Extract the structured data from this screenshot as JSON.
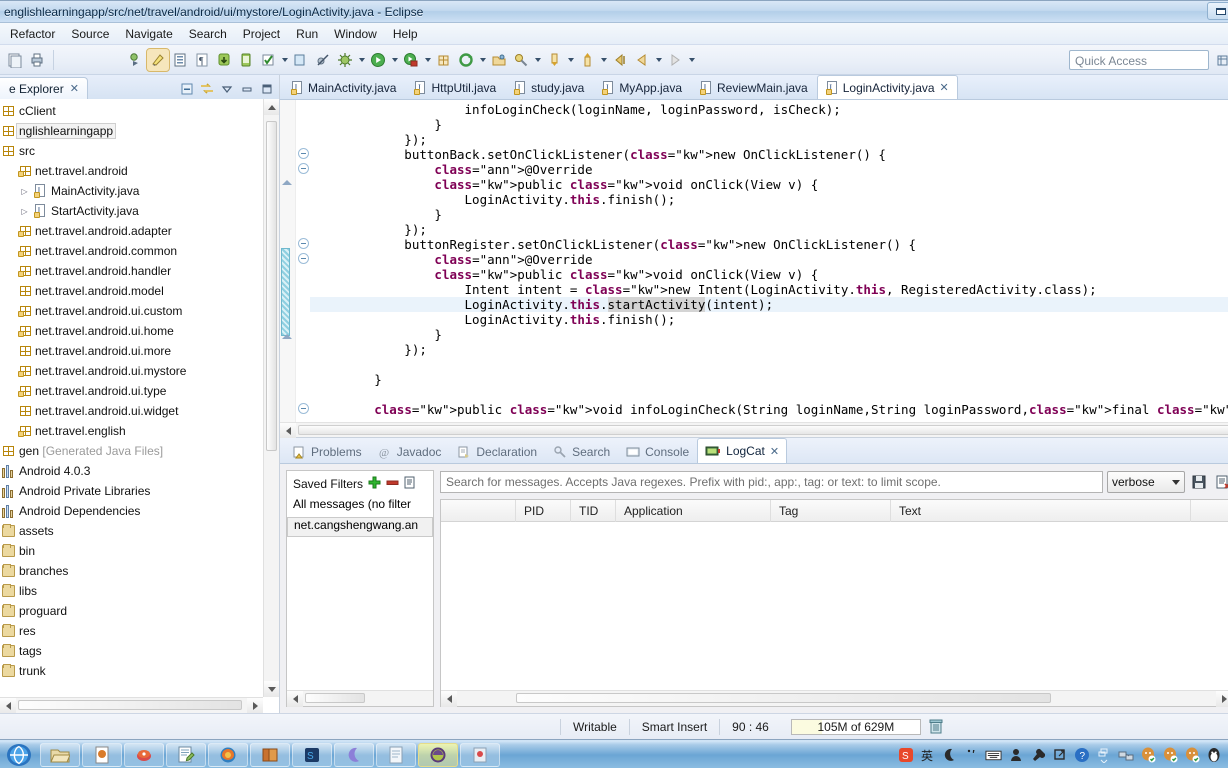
{
  "window": {
    "title": "englishlearningapp/src/net/travel/android/ui/mystore/LoginActivity.java - Eclipse",
    "restore_button": "restore-button"
  },
  "menubar": {
    "items": [
      "Refactor",
      "Source",
      "Navigate",
      "Search",
      "Project",
      "Run",
      "Window",
      "Help"
    ]
  },
  "toolbar": {
    "quick_access_placeholder": "Quick Access",
    "icons": [
      "new-wizard-icon",
      "print-icon",
      "debug-as-icon",
      "edit-highlight-icon",
      "toggle-block-selection-icon",
      "show-whitespace-icon",
      "android-sdk-manager-icon",
      "android-virtual-device-manager-icon",
      "check-icon",
      "new-android-icon",
      "skip-breakpoints-icon",
      "debug-icon",
      "run-icon",
      "run-coverage-icon",
      "new-java-package-icon",
      "refresh-icon",
      "open-folder-icon",
      "search-icon",
      "previous-edit-icon",
      "next-annotation-icon",
      "back-icon",
      "forward-icon"
    ]
  },
  "explorer": {
    "tab_label": "e Explorer",
    "tools": [
      "collapse-all-icon",
      "link-with-editor-icon",
      "view-menu-icon",
      "minimize-icon",
      "maximize-icon"
    ],
    "tree": [
      {
        "label": "cClient",
        "icon": "project-icon",
        "indent": 0,
        "arrow": "",
        "selected": false,
        "gray": false
      },
      {
        "label": "nglishlearningapp",
        "icon": "project-icon",
        "indent": 0,
        "arrow": "",
        "selected": true,
        "gray": false
      },
      {
        "label": "src",
        "icon": "source-folder-icon",
        "indent": 0,
        "arrow": "",
        "selected": false,
        "gray": false
      },
      {
        "label": "net.travel.android",
        "icon": "package-icon",
        "indent": 1,
        "arrow": "",
        "selected": false,
        "gray": false
      },
      {
        "label": "MainActivity.java",
        "icon": "java-file-icon",
        "indent": 2,
        "arrow": "collapsed",
        "selected": false,
        "gray": false
      },
      {
        "label": "StartActivity.java",
        "icon": "java-file-icon",
        "indent": 2,
        "arrow": "collapsed",
        "selected": false,
        "gray": false
      },
      {
        "label": "net.travel.android.adapter",
        "icon": "package-icon",
        "indent": 1,
        "arrow": "",
        "selected": false,
        "gray": false
      },
      {
        "label": "net.travel.android.common",
        "icon": "package-icon",
        "indent": 1,
        "arrow": "",
        "selected": false,
        "gray": false
      },
      {
        "label": "net.travel.android.handler",
        "icon": "package-icon",
        "indent": 1,
        "arrow": "",
        "selected": false,
        "gray": false
      },
      {
        "label": "net.travel.android.model",
        "icon": "package-empty-icon",
        "indent": 1,
        "arrow": "",
        "selected": false,
        "gray": false
      },
      {
        "label": "net.travel.android.ui.custom",
        "icon": "package-icon",
        "indent": 1,
        "arrow": "",
        "selected": false,
        "gray": false
      },
      {
        "label": "net.travel.android.ui.home",
        "icon": "package-icon",
        "indent": 1,
        "arrow": "",
        "selected": false,
        "gray": false
      },
      {
        "label": "net.travel.android.ui.more",
        "icon": "package-empty-icon",
        "indent": 1,
        "arrow": "",
        "selected": false,
        "gray": false
      },
      {
        "label": "net.travel.android.ui.mystore",
        "icon": "package-icon",
        "indent": 1,
        "arrow": "",
        "selected": false,
        "gray": false
      },
      {
        "label": "net.travel.android.ui.type",
        "icon": "package-icon",
        "indent": 1,
        "arrow": "",
        "selected": false,
        "gray": false
      },
      {
        "label": "net.travel.android.ui.widget",
        "icon": "package-empty-icon",
        "indent": 1,
        "arrow": "",
        "selected": false,
        "gray": false
      },
      {
        "label": "net.travel.english",
        "icon": "package-icon",
        "indent": 1,
        "arrow": "",
        "selected": false,
        "gray": false
      },
      {
        "label": "gen [Generated Java Files]",
        "icon": "source-folder-icon",
        "indent": 0,
        "arrow": "",
        "selected": false,
        "gray": true
      },
      {
        "label": "Android 4.0.3",
        "icon": "library-icon",
        "indent": 0,
        "arrow": "",
        "selected": false,
        "gray": false
      },
      {
        "label": "Android Private Libraries",
        "icon": "library-icon",
        "indent": 0,
        "arrow": "",
        "selected": false,
        "gray": false
      },
      {
        "label": "Android Dependencies",
        "icon": "library-icon",
        "indent": 0,
        "arrow": "",
        "selected": false,
        "gray": false
      },
      {
        "label": "assets",
        "icon": "folder-icon",
        "indent": 0,
        "arrow": "collapsed",
        "selected": false,
        "gray": false
      },
      {
        "label": "bin",
        "icon": "folder-icon",
        "indent": 0,
        "arrow": "collapsed",
        "selected": false,
        "gray": false
      },
      {
        "label": "branches",
        "icon": "folder-icon",
        "indent": 0,
        "arrow": "collapsed",
        "selected": false,
        "gray": false
      },
      {
        "label": "libs",
        "icon": "folder-icon",
        "indent": 0,
        "arrow": "collapsed",
        "selected": false,
        "gray": false
      },
      {
        "label": "proguard",
        "icon": "folder-icon",
        "indent": 0,
        "arrow": "collapsed",
        "selected": false,
        "gray": false
      },
      {
        "label": "res",
        "icon": "folder-icon",
        "indent": 0,
        "arrow": "collapsed",
        "selected": false,
        "gray": false
      },
      {
        "label": "tags",
        "icon": "folder-icon",
        "indent": 0,
        "arrow": "collapsed",
        "selected": false,
        "gray": false
      },
      {
        "label": "trunk",
        "icon": "folder-icon",
        "indent": 0,
        "arrow": "collapsed",
        "selected": false,
        "gray": false
      }
    ]
  },
  "editor": {
    "tabs": [
      {
        "label": "MainActivity.java",
        "active": false
      },
      {
        "label": "HttpUtil.java",
        "active": false
      },
      {
        "label": "study.java",
        "active": false
      },
      {
        "label": "MyApp.java",
        "active": false
      },
      {
        "label": "ReviewMain.java",
        "active": false
      },
      {
        "label": "LoginActivity.java",
        "active": true
      }
    ],
    "code_lines": [
      {
        "text": "                    infoLoginCheck(loginName, loginPassword, isCheck);",
        "hl": false
      },
      {
        "text": "                }",
        "hl": false
      },
      {
        "text": "            });",
        "hl": false
      },
      {
        "text": "            buttonBack.setOnClickListener(new OnClickListener() {",
        "hl": false
      },
      {
        "text": "                @Override",
        "hl": false
      },
      {
        "text": "                public void onClick(View v) {",
        "hl": false
      },
      {
        "text": "                    LoginActivity.this.finish();",
        "hl": false
      },
      {
        "text": "                }",
        "hl": false
      },
      {
        "text": "            });",
        "hl": false
      },
      {
        "text": "            buttonRegister.setOnClickListener(new OnClickListener() {",
        "hl": false
      },
      {
        "text": "                @Override",
        "hl": false
      },
      {
        "text": "                public void onClick(View v) {",
        "hl": false
      },
      {
        "text": "                    Intent intent = new Intent(LoginActivity.this, RegisteredActivity.class);",
        "hl": false
      },
      {
        "text": "                    LoginActivity.this.startActivity(intent);",
        "hl": true
      },
      {
        "text": "                    LoginActivity.this.finish();",
        "hl": false
      },
      {
        "text": "                }",
        "hl": false
      },
      {
        "text": "            });",
        "hl": false
      },
      {
        "text": "",
        "hl": false
      },
      {
        "text": "        }",
        "hl": false
      },
      {
        "text": "",
        "hl": false
      },
      {
        "text": "        public void infoLoginCheck(String loginName,String loginPassword,final boolean isCheck){",
        "hl": false
      }
    ]
  },
  "logcat": {
    "tabs": [
      {
        "label": "Problems",
        "icon": "problems-icon",
        "active": false
      },
      {
        "label": "Javadoc",
        "icon": "javadoc-icon",
        "active": false
      },
      {
        "label": "Declaration",
        "icon": "declaration-icon",
        "active": false
      },
      {
        "label": "Search",
        "icon": "search-icon",
        "active": false
      },
      {
        "label": "Console",
        "icon": "console-icon",
        "active": false
      },
      {
        "label": "LogCat",
        "icon": "logcat-icon",
        "active": true
      }
    ],
    "filters": {
      "title": "Saved Filters",
      "add_icon": "add-filter-icon",
      "remove_icon": "remove-filter-icon",
      "edit_icon": "edit-filter-icon",
      "items": [
        {
          "label": "All messages (no filter",
          "selected": false
        },
        {
          "label": "net.cangshengwang.an",
          "selected": true
        }
      ]
    },
    "search_placeholder": "Search for messages. Accepts Java regexes. Prefix with pid:, app:, tag: or text: to limit scope.",
    "level": "verbose",
    "save_icon": "save-log-icon",
    "clear_icon": "clear-log-icon",
    "columns": [
      "PID",
      "TID",
      "Application",
      "Tag",
      "Text"
    ],
    "rows": []
  },
  "statusbar": {
    "writable": "Writable",
    "insert_mode": "Smart Insert",
    "position": "90 : 46",
    "heap": "105M of 629M",
    "trash_icon": "trash-icon"
  },
  "taskbar": {
    "start": "start-orb",
    "apps": [
      "explorer-icon",
      "acrobat-icon",
      "media-icon",
      "notepad-plus-icon",
      "firefox-icon",
      "dictionary-icon",
      "photoshop-icon",
      "moon-icon",
      "notepad-icon",
      "eclipse-icon",
      "app-icon"
    ],
    "tray": [
      "sogou-icon",
      "ime-chinese-icon",
      "ime-moon-icon",
      "ime-punctuation-icon",
      "ime-keyboard-icon",
      "ime-user-icon",
      "ime-settings-icon",
      "ime-expand-icon",
      "help-icon",
      "show-hidden-icon",
      "network-icon",
      "qq-icon-1",
      "qq-icon-2",
      "qq-icon-3",
      "penguin-icon"
    ]
  },
  "colors": {
    "keyword": "#7f0055",
    "annotation": "#646464",
    "line_highlight": "#eaf3fb",
    "occurrence": "#d4d4d4",
    "title_bar": "#c3d9ef",
    "taskbar": "#6ba5d4"
  }
}
